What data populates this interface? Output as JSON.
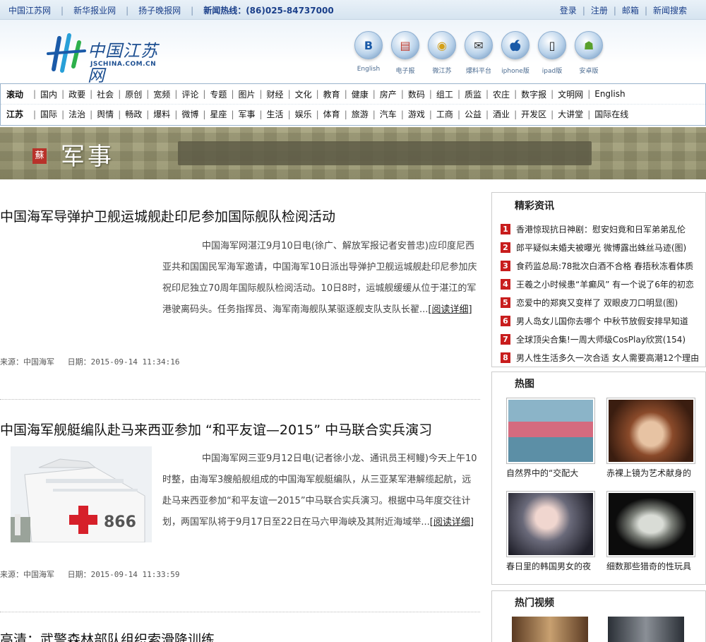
{
  "topbar": {
    "links": [
      "中国江苏网",
      "新华报业网",
      "扬子晚报网"
    ],
    "hotline": "新闻热线：(86)025-84737000",
    "right_links": [
      "登录",
      "注册",
      "邮箱",
      "新闻搜索"
    ]
  },
  "logo": {
    "name": "中国江苏网",
    "domain": "JSCHINA.COM.CN"
  },
  "apps": [
    {
      "label": "English",
      "icon": "english-icon",
      "glyph": "B"
    },
    {
      "label": "电子报",
      "icon": "epaper-icon",
      "glyph": "▤"
    },
    {
      "label": "微江苏",
      "icon": "weibo-icon",
      "glyph": "◉"
    },
    {
      "label": "爆料平台",
      "icon": "tipoff-icon",
      "glyph": "✉"
    },
    {
      "label": "iphone版",
      "icon": "apple-icon",
      "glyph": ""
    },
    {
      "label": "ipad版",
      "icon": "ipad-icon",
      "glyph": "▯"
    },
    {
      "label": "安卓版",
      "icon": "android-icon",
      "glyph": "☗"
    }
  ],
  "nav": {
    "row1": [
      "滚动",
      "国内",
      "政要",
      "社会",
      "原创",
      "宽频",
      "评论",
      "专题",
      "图片",
      "财经",
      "文化",
      "教育",
      "健康",
      "房产",
      "数码",
      "组工",
      "质监",
      "农庄",
      "数字报",
      "文明网",
      "English"
    ],
    "row2": [
      "江苏",
      "国际",
      "法治",
      "舆情",
      "畅政",
      "爆料",
      "微博",
      "星座",
      "军事",
      "生活",
      "娱乐",
      "体育",
      "旅游",
      "汽车",
      "游戏",
      "工商",
      "公益",
      "酒业",
      "开发区",
      "大讲堂",
      "国际在线"
    ]
  },
  "banner": {
    "seal": "蘇",
    "title": "军事"
  },
  "articles": [
    {
      "title": "中国海军导弹护卫舰运城舰赴印尼参加国际舰队检阅活动",
      "body": "中国海军网湛江9月10日电(徐广、解放军报记者安普忠)应印度尼西亚共和国国民军海军邀请，中国海军10日派出导弹护卫舰运城舰赴印尼参加庆祝印尼独立70周年国际舰队检阅活动。10日8时，运城舰缓缓从位于湛江的军港驶离码头。任务指挥员、海军南海舰队某驱逐舰支队支队长翟...",
      "more": "[阅读详细]",
      "source_label": "来源：",
      "source": "中国海军",
      "date_label": "日期：",
      "date": "2015-09-14 11:34:16"
    },
    {
      "title": "中国海军舰艇编队赴马来西亚参加 “和平友谊—2015” 中马联合实兵演习",
      "body": "中国海军网三亚9月12日电(记者徐小龙、通讯员王柯鳗)今天上午10时整，由海军3艘船舰组成的中国海军舰艇编队，从三亚某军港解缆起航，远赴马来西亚参加“和平友谊一2015”中马联合实兵演习。根据中马年度交往计划，两国军队将于9月17日至22日在马六甲海峡及其附近海域举...",
      "more": "[阅读详细]",
      "source_label": "来源：",
      "source": "中国海军",
      "date_label": "日期：",
      "date": "2015-09-14 11:33:59"
    },
    {
      "title": "高清：武警森林部队组织索滑降训练"
    }
  ],
  "sidebar": {
    "featured_title": "精彩资讯",
    "featured": [
      "香港惊现抗日神剧：慰安妇竟和日军弟弟乱伦",
      "郎平疑似未婚夫被曝光 微博露出蛛丝马迹(图)",
      "食药监总局:78批次白酒不合格 春捂秋冻看体质",
      "王羲之小时候患“羊癫风” 有一个说了6年的初恋",
      "恋爱中的郑爽又变样了 双眼皮刀口明显(图)",
      "男人岛女儿国你去哪个 中秋节放假安排早知道",
      "全球顶尖合集!一周大师级CosPlay欣赏(154)",
      "男人性生活多久一次合适 女人需要高潮12个理由"
    ],
    "pics_title": "热图",
    "pics": [
      {
        "caption": "自然界中的“交配大"
      },
      {
        "caption": "赤裸上镜为艺术献身的"
      },
      {
        "caption": "春日里的韩国男女的夜"
      },
      {
        "caption": "细数那些猎奇的性玩具"
      }
    ],
    "video_title": "热门视频"
  }
}
